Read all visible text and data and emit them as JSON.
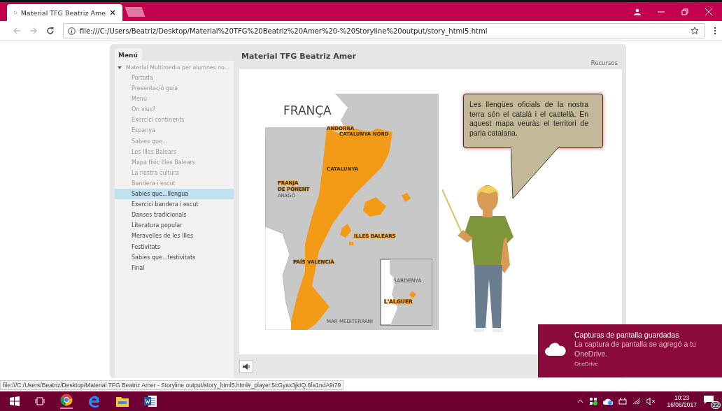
{
  "browser": {
    "tab_title": "Material TFG Beatriz Ame",
    "url": "file:///C:/Users/Beatriz/Desktop/Material%20TFG%20Beatriz%20Amer%20-%20Storyline%20output/story_html5.html",
    "status_url": "file:///C:/Users/Beatriz/Desktop/Material TFG Beatriz Amer - Storyline output/story_html5.html#_player.5cGyax3jkIQ.6fa1ndA9i79"
  },
  "sidebar": {
    "tab": "Menú",
    "root": {
      "label": "Material Multimedia per alumnes no...",
      "expanded": true,
      "children": [
        {
          "label": "Portada",
          "visited": true,
          "selected": false
        },
        {
          "label": "Presentació guia",
          "visited": true,
          "selected": false
        },
        {
          "label": "Menú",
          "visited": true,
          "selected": false
        },
        {
          "label": "On vius?",
          "visited": true,
          "selected": false
        },
        {
          "label": "Exercici continents",
          "visited": true,
          "selected": false
        },
        {
          "label": "Espanya",
          "visited": true,
          "selected": false
        },
        {
          "label": "Sabies que...",
          "visited": true,
          "selected": false
        },
        {
          "label": "Les Illes Balears",
          "visited": true,
          "selected": false
        },
        {
          "label": "Mapa físic Illes Balears",
          "visited": true,
          "selected": false
        },
        {
          "label": "La nostra cultura",
          "visited": true,
          "selected": false
        },
        {
          "label": "Bandera i escut",
          "visited": true,
          "selected": false
        },
        {
          "label": "Sabies que...llengua",
          "visited": false,
          "selected": true
        },
        {
          "label": "Exercici bandera i escut",
          "visited": false,
          "selected": false
        },
        {
          "label": "Danses tradicionals",
          "visited": false,
          "selected": false
        },
        {
          "label": "Literatura popular",
          "visited": false,
          "selected": false
        },
        {
          "label": "Meravelles de les Illes",
          "visited": false,
          "selected": false
        },
        {
          "label": "Festivitats",
          "visited": false,
          "selected": false
        },
        {
          "label": "Sabies que...festivitats",
          "visited": false,
          "selected": false
        },
        {
          "label": "Final",
          "visited": false,
          "selected": false
        }
      ]
    }
  },
  "player": {
    "title": "Material TFG Beatriz Amer",
    "resources": "Recursos"
  },
  "slide": {
    "map_labels": [
      "FRANÇA",
      "ANDORRA",
      "CATALUNYA NORD",
      "CATALUNYA",
      "FRANJA",
      "DE PONENT",
      "ARAGÓ",
      "ILLES BALEARS",
      "PAÍS VALENCIÀ",
      "SARDENYA",
      "L'ALGUER",
      "MAR MEDITERRANI"
    ],
    "speech": "Les llengües oficials de la nostra terra són el català i el castellà. En aquest mapa veuràs el territori de parla catalana."
  },
  "notification": {
    "title": "Capturas de pantalla guardadas",
    "body": "La captura de pantalla se agregó a tu OneDrive.",
    "source": "OneDrive"
  },
  "taskbar": {
    "time": "10:23",
    "date": "16/06/2017",
    "notifications": "22"
  }
}
